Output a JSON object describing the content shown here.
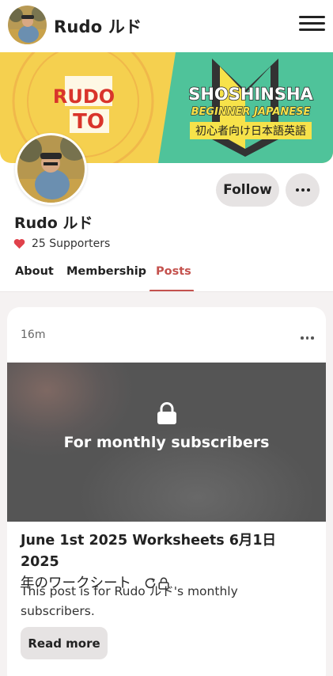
{
  "header": {
    "title": "Rudo ルド",
    "menu_icon": "hamburger-menu-icon"
  },
  "banner": {
    "left_logo_line1": "RUDO",
    "left_logo_line2": "TO",
    "brand_title": "SHOSHINSHA",
    "brand_subtitle": "BEGINNER JAPANESE",
    "brand_tagline": "初心者向け日本語英語",
    "colors": {
      "left": "#f5d04f",
      "right": "#4fc39a",
      "text_red": "#d9342b",
      "tag_yellow": "#f7e24a"
    }
  },
  "profile": {
    "name": "Rudo ルド",
    "supporters": "25 Supporters",
    "follow_label": "Follow",
    "more_icon": "more-horizontal-icon",
    "heart_color": "#e0414b"
  },
  "tabs": [
    {
      "label": "About",
      "active": false
    },
    {
      "label": "Membership",
      "active": false
    },
    {
      "label": "Posts",
      "active": true
    }
  ],
  "post": {
    "time": "16m",
    "locked_message": "For monthly subscribers",
    "title_line1": "June 1st 2025 Worksheets 6月1日2025",
    "title_line2": "年のワークシート",
    "body": "This post is for Rudo ルド's monthly subscribers.",
    "read_more_label": "Read more"
  },
  "accent_color": "#c4524e"
}
